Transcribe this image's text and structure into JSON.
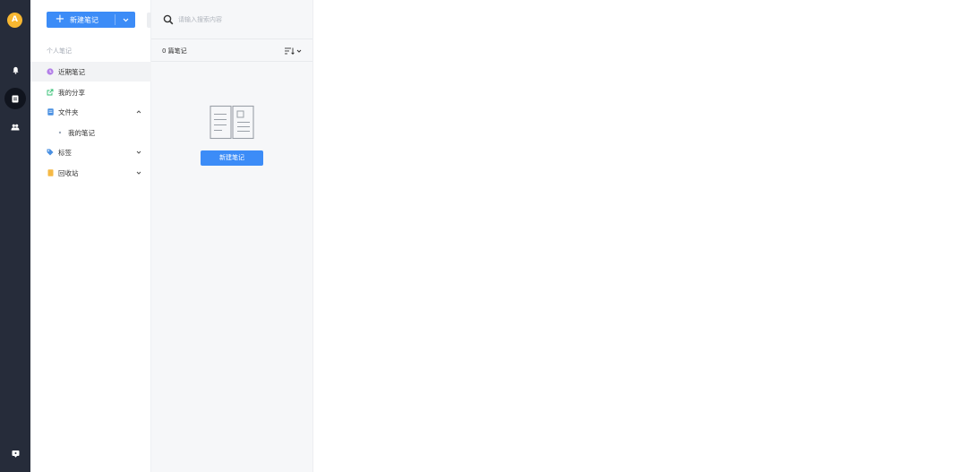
{
  "user": {
    "avatar_letter": "A"
  },
  "colors": {
    "accent": "#3c8cf7",
    "rail_bg": "#262c3a",
    "avatar_bg": "#f7b731"
  },
  "rail": {
    "items": [
      {
        "icon": "bell-icon"
      },
      {
        "icon": "note-icon",
        "active": true
      },
      {
        "icon": "team-icon"
      }
    ],
    "bottom_icon": "feedback-icon"
  },
  "sidebar": {
    "new_button_label": "新建笔记",
    "section_title": "个人笔记",
    "items": [
      {
        "label": "近期笔记",
        "icon": "clock-icon",
        "color": "#b37fe8"
      },
      {
        "label": "我的分享",
        "icon": "share-icon",
        "color": "#2fbf71"
      },
      {
        "label": "文件夹",
        "icon": "folder-icon",
        "color": "#4a90e2",
        "expanded": true
      },
      {
        "label": "我的笔记",
        "icon": "bullet-icon"
      },
      {
        "label": "标签",
        "icon": "tag-icon",
        "color": "#4a90e2"
      },
      {
        "label": "回收站",
        "icon": "trash-icon",
        "color": "#f5b945"
      }
    ]
  },
  "list_panel": {
    "search_placeholder": "请输入搜索内容",
    "count_label": "0 篇笔记",
    "empty_button_label": "新建笔记"
  }
}
